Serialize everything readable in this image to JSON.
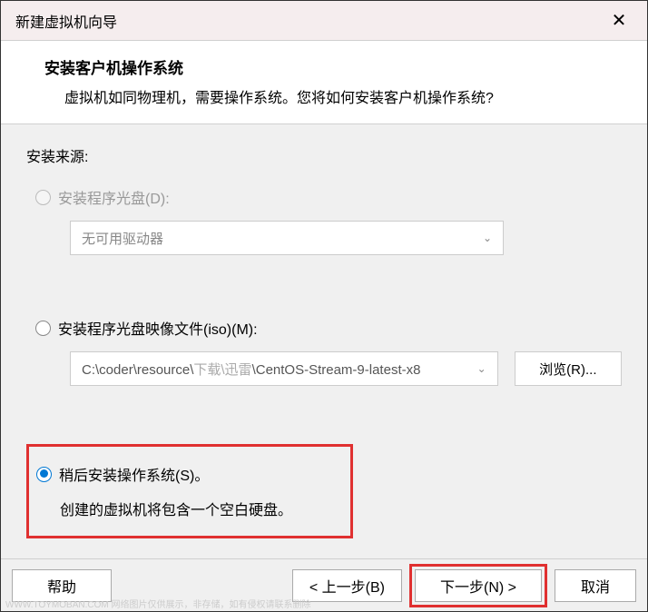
{
  "titlebar": {
    "title": "新建虚拟机向导",
    "close": "✕"
  },
  "header": {
    "title": "安装客户机操作系统",
    "subtitle": "虚拟机如同物理机，需要操作系统。您将如何安装客户机操作系统?"
  },
  "source_label": "安装来源:",
  "opt_disc": {
    "label": "安装程序光盘(D):",
    "dropdown": "无可用驱动器"
  },
  "opt_iso": {
    "label": "安装程序光盘映像文件(iso)(M):",
    "path_prefix": "C:\\coder\\resource\\",
    "path_grey": "下载\\迅雷",
    "path_suffix": "\\CentOS-Stream-9-latest-x8",
    "browse": "浏览(R)..."
  },
  "opt_later": {
    "label": "稍后安装操作系统(S)。",
    "note": "创建的虚拟机将包含一个空白硬盘。"
  },
  "footer": {
    "help": "帮助",
    "back": "< 上一步(B)",
    "next": "下一步(N) >",
    "cancel": "取消"
  },
  "watermark": "WWW.TOYMOBAN.COM  网络图片仅供展示，非存储，如有侵权请联系删除"
}
